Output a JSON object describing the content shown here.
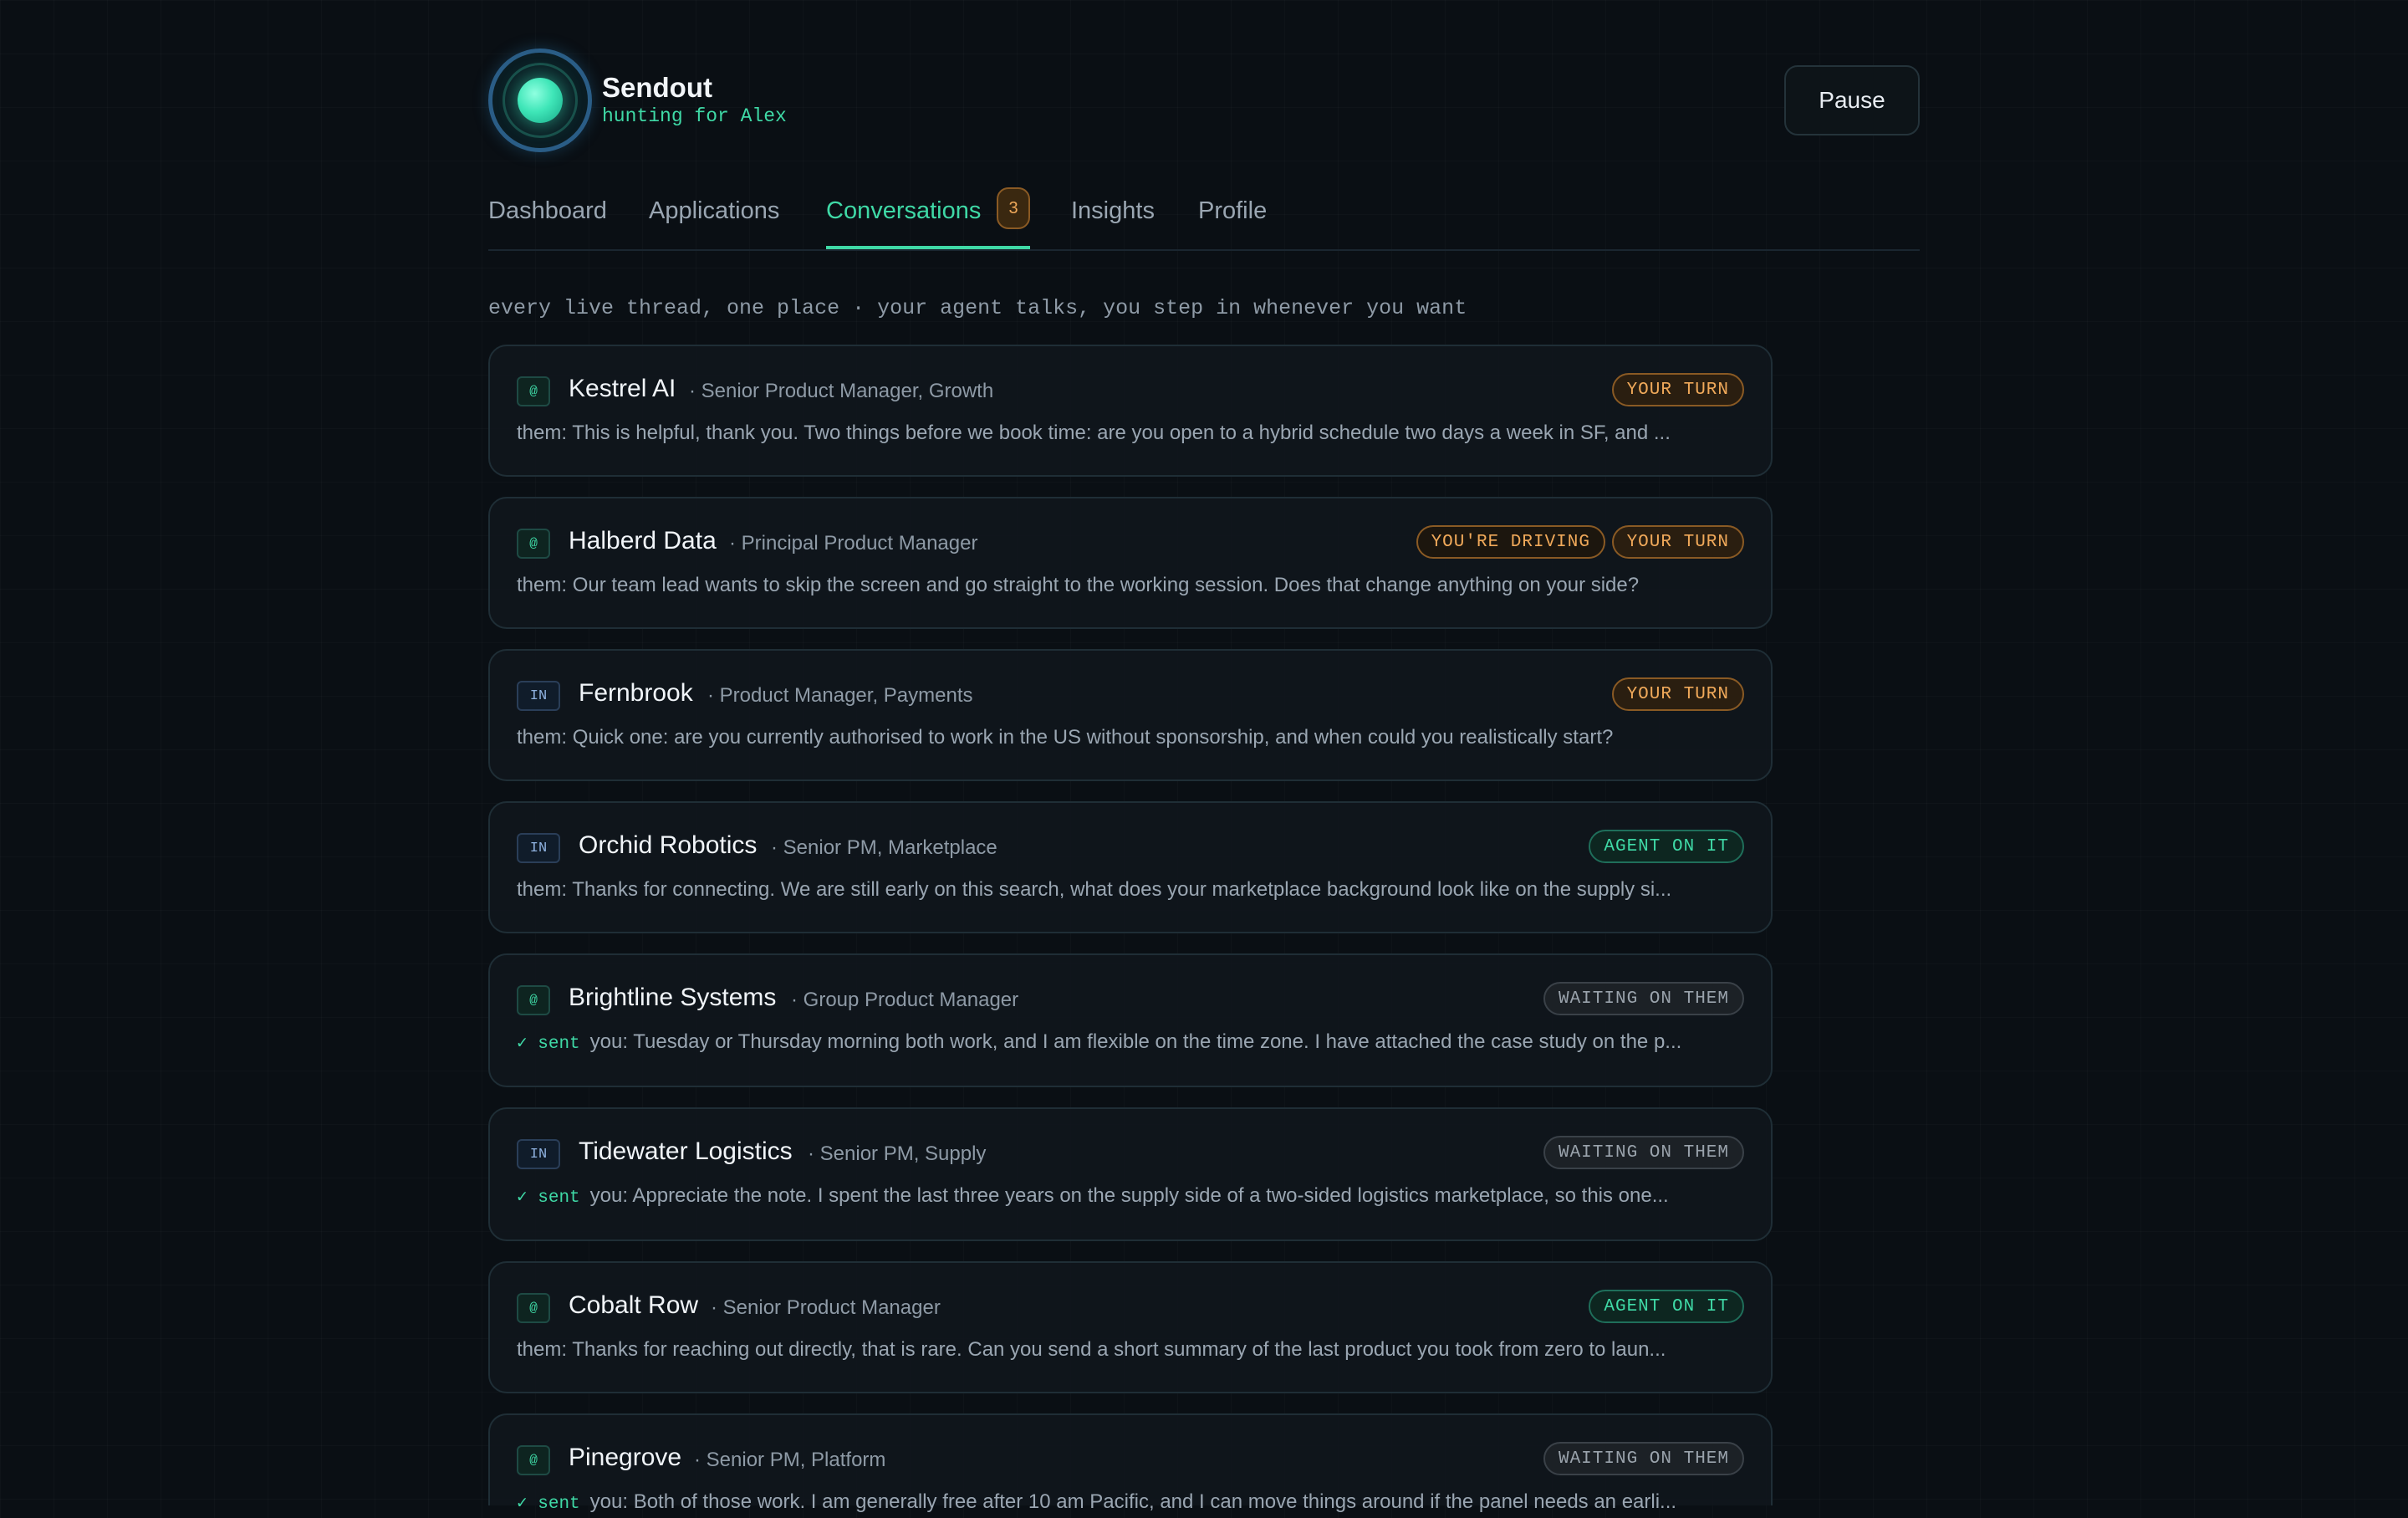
{
  "brand": {
    "name": "Sendout",
    "subtitle": "hunting for Alex"
  },
  "header": {
    "pause_label": "Pause"
  },
  "tabs": [
    {
      "label": "Dashboard"
    },
    {
      "label": "Applications"
    },
    {
      "label": "Conversations",
      "badge": "3",
      "active": true
    },
    {
      "label": "Insights"
    },
    {
      "label": "Profile"
    }
  ],
  "tagline": "every live thread, one place · your agent talks, you step in whenever you want",
  "conversations": [
    {
      "source": "@",
      "company": "Kestrel AI",
      "role": "· Senior Product Manager, Growth",
      "badges": [
        "YOUR TURN"
      ],
      "message": "them: This is helpful, thank you. Two things before we book time: are you open to a hybrid schedule two days a week in SF, and ..."
    },
    {
      "source": "@",
      "company": "Halberd Data",
      "role": "· Principal Product Manager",
      "badges": [
        "YOU'RE DRIVING",
        "YOUR TURN"
      ],
      "message": "them: Our team lead wants to skip the screen and go straight to the working session. Does that change anything on your side?"
    },
    {
      "source": "IN",
      "company": "Fernbrook",
      "role": "· Product Manager, Payments",
      "badges": [
        "YOUR TURN"
      ],
      "message": "them: Quick one: are you currently authorised to work in the US without sponsorship, and when could you realistically start?"
    },
    {
      "source": "IN",
      "company": "Orchid Robotics",
      "role": "· Senior PM, Marketplace",
      "badges": [
        "AGENT ON IT"
      ],
      "message": "them: Thanks for connecting. We are still early on this search, what does your marketplace background look like on the supply si..."
    },
    {
      "source": "@",
      "company": "Brightline Systems",
      "role": "· Group Product Manager",
      "badges": [
        "WAITING ON THEM"
      ],
      "sent": "✓ sent",
      "message": "you: Tuesday or Thursday morning both work, and I am flexible on the time zone. I have attached the case study on the p..."
    },
    {
      "source": "IN",
      "company": "Tidewater Logistics",
      "role": "· Senior PM, Supply",
      "badges": [
        "WAITING ON THEM"
      ],
      "sent": "✓ sent",
      "message": "you: Appreciate the note. I spent the last three years on the supply side of a two-sided logistics marketplace, so this one..."
    },
    {
      "source": "@",
      "company": "Cobalt Row",
      "role": "· Senior Product Manager",
      "badges": [
        "AGENT ON IT"
      ],
      "message": "them: Thanks for reaching out directly, that is rare. Can you send a short summary of the last product you took from zero to laun..."
    },
    {
      "source": "@",
      "company": "Pinegrove",
      "role": "· Senior PM, Platform",
      "badges": [
        "WAITING ON THEM"
      ],
      "sent": "✓ sent",
      "message": "you: Both of those work. I am generally free after 10 am Pacific, and I can move things around if the panel needs an earli..."
    }
  ],
  "colors": {
    "accent": "#3fd9a6",
    "your_turn": "#f0a95a",
    "agent_on_it": "#3fd9a6",
    "waiting": "#9aa3ac",
    "background": "#0a0f14"
  }
}
